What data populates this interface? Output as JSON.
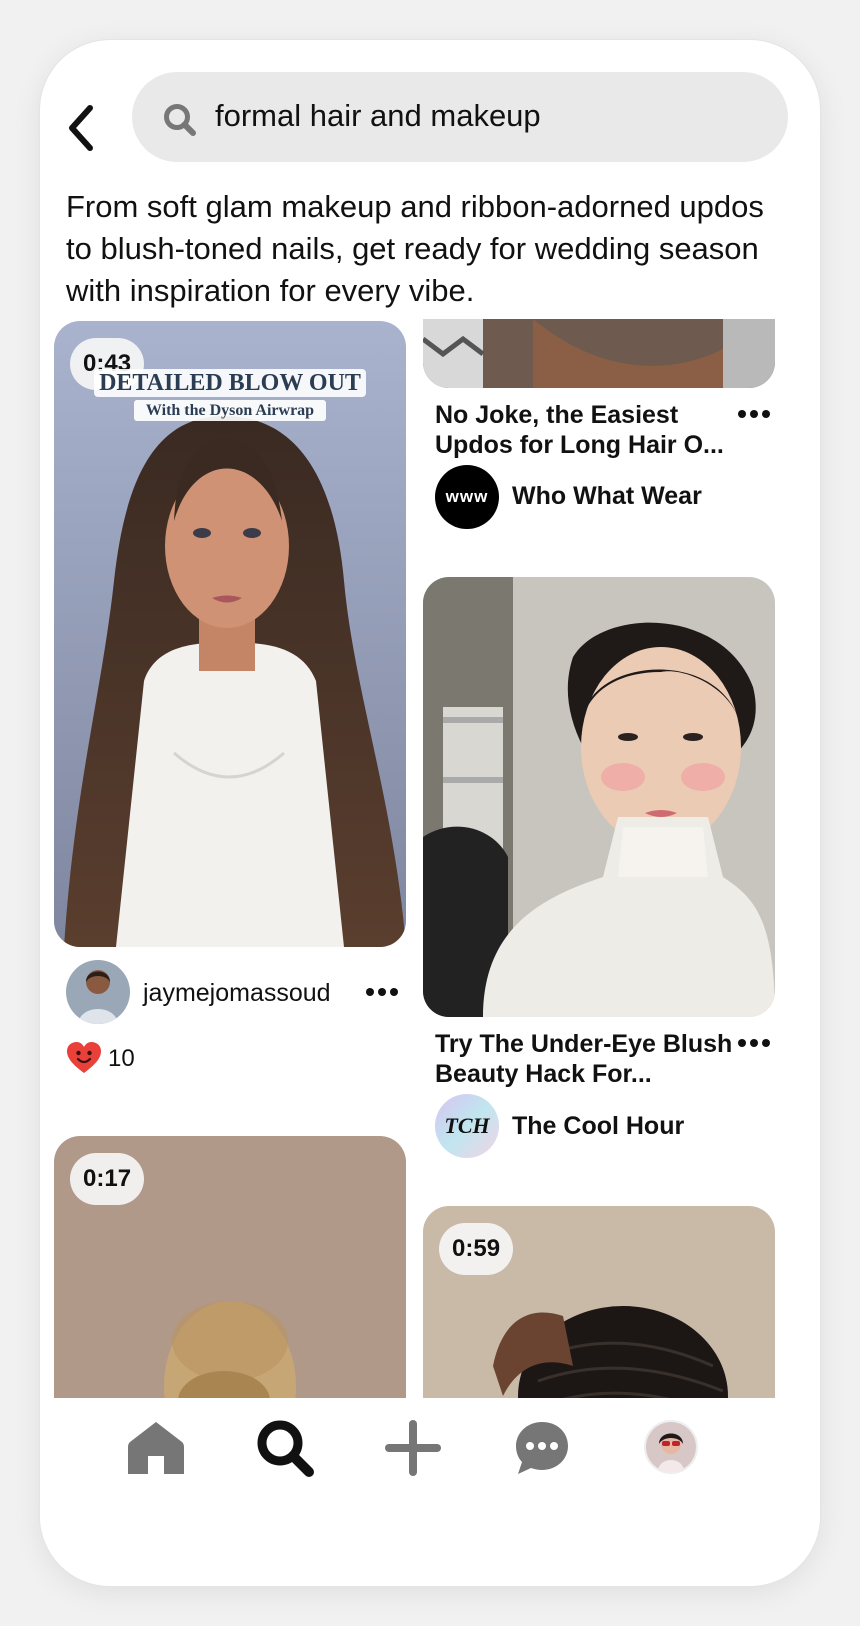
{
  "search": {
    "query": "formal hair and makeup"
  },
  "description": "From soft glam makeup and ribbon-adorned updos to blush-toned nails, get ready for wedding season with inspiration for every vibe.",
  "pins": {
    "p1": {
      "duration": "0:43",
      "overlay_title": "DETAILED BLOW OUT",
      "overlay_sub": "With the Dyson Airwrap",
      "creator": "jaymejomassoud",
      "likes": "10"
    },
    "p2": {
      "title": "No Joke, the Easiest Updos for Long Hair O...",
      "source": "Who What Wear",
      "source_logo": "www"
    },
    "p3": {
      "title": "Try The Under-Eye Blush Beauty Hack For...",
      "source": "The Cool Hour",
      "source_logo": "TCH"
    },
    "p4": {
      "duration": "0:17"
    },
    "p5": {
      "duration": "0:59"
    }
  },
  "nav": {
    "items": [
      "home-icon",
      "search-icon",
      "plus-icon",
      "chat-icon",
      "profile-avatar"
    ]
  },
  "colors": {
    "accent_heart": "#e9403a",
    "search_bg": "#e9e9e9"
  }
}
